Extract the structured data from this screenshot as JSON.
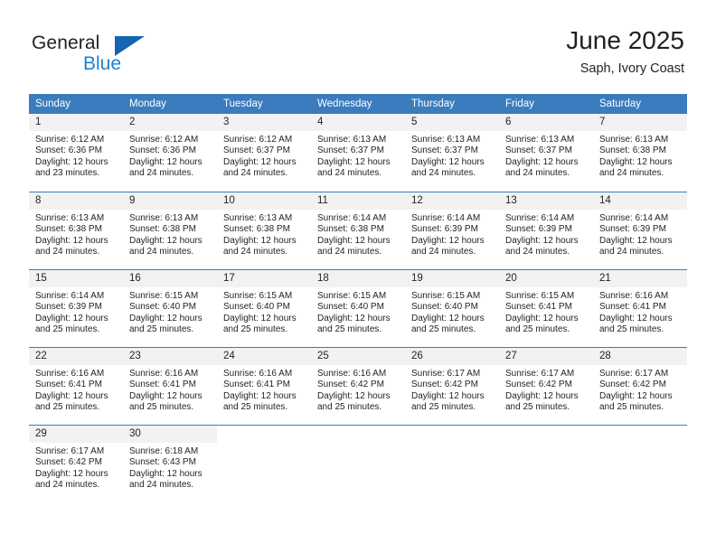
{
  "logo": {
    "word_top": "General",
    "word_bottom": "Blue",
    "triangle_color": "#1565b0",
    "blue_color": "#1f7fd1"
  },
  "header": {
    "title": "June 2025",
    "subtitle": "Saph, Ivory Coast"
  },
  "theme": {
    "header_blue": "#3a7cbe",
    "daynum_gray": "#f2f2f2",
    "text": "#231f20"
  },
  "weekday_headers": [
    "Sunday",
    "Monday",
    "Tuesday",
    "Wednesday",
    "Thursday",
    "Friday",
    "Saturday"
  ],
  "weeks": [
    [
      {
        "day": "1",
        "sunrise": "Sunrise: 6:12 AM",
        "sunset": "Sunset: 6:36 PM",
        "daylight_1": "Daylight: 12 hours",
        "daylight_2": "and 23 minutes."
      },
      {
        "day": "2",
        "sunrise": "Sunrise: 6:12 AM",
        "sunset": "Sunset: 6:36 PM",
        "daylight_1": "Daylight: 12 hours",
        "daylight_2": "and 24 minutes."
      },
      {
        "day": "3",
        "sunrise": "Sunrise: 6:12 AM",
        "sunset": "Sunset: 6:37 PM",
        "daylight_1": "Daylight: 12 hours",
        "daylight_2": "and 24 minutes."
      },
      {
        "day": "4",
        "sunrise": "Sunrise: 6:13 AM",
        "sunset": "Sunset: 6:37 PM",
        "daylight_1": "Daylight: 12 hours",
        "daylight_2": "and 24 minutes."
      },
      {
        "day": "5",
        "sunrise": "Sunrise: 6:13 AM",
        "sunset": "Sunset: 6:37 PM",
        "daylight_1": "Daylight: 12 hours",
        "daylight_2": "and 24 minutes."
      },
      {
        "day": "6",
        "sunrise": "Sunrise: 6:13 AM",
        "sunset": "Sunset: 6:37 PM",
        "daylight_1": "Daylight: 12 hours",
        "daylight_2": "and 24 minutes."
      },
      {
        "day": "7",
        "sunrise": "Sunrise: 6:13 AM",
        "sunset": "Sunset: 6:38 PM",
        "daylight_1": "Daylight: 12 hours",
        "daylight_2": "and 24 minutes."
      }
    ],
    [
      {
        "day": "8",
        "sunrise": "Sunrise: 6:13 AM",
        "sunset": "Sunset: 6:38 PM",
        "daylight_1": "Daylight: 12 hours",
        "daylight_2": "and 24 minutes."
      },
      {
        "day": "9",
        "sunrise": "Sunrise: 6:13 AM",
        "sunset": "Sunset: 6:38 PM",
        "daylight_1": "Daylight: 12 hours",
        "daylight_2": "and 24 minutes."
      },
      {
        "day": "10",
        "sunrise": "Sunrise: 6:13 AM",
        "sunset": "Sunset: 6:38 PM",
        "daylight_1": "Daylight: 12 hours",
        "daylight_2": "and 24 minutes."
      },
      {
        "day": "11",
        "sunrise": "Sunrise: 6:14 AM",
        "sunset": "Sunset: 6:38 PM",
        "daylight_1": "Daylight: 12 hours",
        "daylight_2": "and 24 minutes."
      },
      {
        "day": "12",
        "sunrise": "Sunrise: 6:14 AM",
        "sunset": "Sunset: 6:39 PM",
        "daylight_1": "Daylight: 12 hours",
        "daylight_2": "and 24 minutes."
      },
      {
        "day": "13",
        "sunrise": "Sunrise: 6:14 AM",
        "sunset": "Sunset: 6:39 PM",
        "daylight_1": "Daylight: 12 hours",
        "daylight_2": "and 24 minutes."
      },
      {
        "day": "14",
        "sunrise": "Sunrise: 6:14 AM",
        "sunset": "Sunset: 6:39 PM",
        "daylight_1": "Daylight: 12 hours",
        "daylight_2": "and 24 minutes."
      }
    ],
    [
      {
        "day": "15",
        "sunrise": "Sunrise: 6:14 AM",
        "sunset": "Sunset: 6:39 PM",
        "daylight_1": "Daylight: 12 hours",
        "daylight_2": "and 25 minutes."
      },
      {
        "day": "16",
        "sunrise": "Sunrise: 6:15 AM",
        "sunset": "Sunset: 6:40 PM",
        "daylight_1": "Daylight: 12 hours",
        "daylight_2": "and 25 minutes."
      },
      {
        "day": "17",
        "sunrise": "Sunrise: 6:15 AM",
        "sunset": "Sunset: 6:40 PM",
        "daylight_1": "Daylight: 12 hours",
        "daylight_2": "and 25 minutes."
      },
      {
        "day": "18",
        "sunrise": "Sunrise: 6:15 AM",
        "sunset": "Sunset: 6:40 PM",
        "daylight_1": "Daylight: 12 hours",
        "daylight_2": "and 25 minutes."
      },
      {
        "day": "19",
        "sunrise": "Sunrise: 6:15 AM",
        "sunset": "Sunset: 6:40 PM",
        "daylight_1": "Daylight: 12 hours",
        "daylight_2": "and 25 minutes."
      },
      {
        "day": "20",
        "sunrise": "Sunrise: 6:15 AM",
        "sunset": "Sunset: 6:41 PM",
        "daylight_1": "Daylight: 12 hours",
        "daylight_2": "and 25 minutes."
      },
      {
        "day": "21",
        "sunrise": "Sunrise: 6:16 AM",
        "sunset": "Sunset: 6:41 PM",
        "daylight_1": "Daylight: 12 hours",
        "daylight_2": "and 25 minutes."
      }
    ],
    [
      {
        "day": "22",
        "sunrise": "Sunrise: 6:16 AM",
        "sunset": "Sunset: 6:41 PM",
        "daylight_1": "Daylight: 12 hours",
        "daylight_2": "and 25 minutes."
      },
      {
        "day": "23",
        "sunrise": "Sunrise: 6:16 AM",
        "sunset": "Sunset: 6:41 PM",
        "daylight_1": "Daylight: 12 hours",
        "daylight_2": "and 25 minutes."
      },
      {
        "day": "24",
        "sunrise": "Sunrise: 6:16 AM",
        "sunset": "Sunset: 6:41 PM",
        "daylight_1": "Daylight: 12 hours",
        "daylight_2": "and 25 minutes."
      },
      {
        "day": "25",
        "sunrise": "Sunrise: 6:16 AM",
        "sunset": "Sunset: 6:42 PM",
        "daylight_1": "Daylight: 12 hours",
        "daylight_2": "and 25 minutes."
      },
      {
        "day": "26",
        "sunrise": "Sunrise: 6:17 AM",
        "sunset": "Sunset: 6:42 PM",
        "daylight_1": "Daylight: 12 hours",
        "daylight_2": "and 25 minutes."
      },
      {
        "day": "27",
        "sunrise": "Sunrise: 6:17 AM",
        "sunset": "Sunset: 6:42 PM",
        "daylight_1": "Daylight: 12 hours",
        "daylight_2": "and 25 minutes."
      },
      {
        "day": "28",
        "sunrise": "Sunrise: 6:17 AM",
        "sunset": "Sunset: 6:42 PM",
        "daylight_1": "Daylight: 12 hours",
        "daylight_2": "and 25 minutes."
      }
    ],
    [
      {
        "day": "29",
        "sunrise": "Sunrise: 6:17 AM",
        "sunset": "Sunset: 6:42 PM",
        "daylight_1": "Daylight: 12 hours",
        "daylight_2": "and 24 minutes."
      },
      {
        "day": "30",
        "sunrise": "Sunrise: 6:18 AM",
        "sunset": "Sunset: 6:43 PM",
        "daylight_1": "Daylight: 12 hours",
        "daylight_2": "and 24 minutes."
      },
      {
        "day": "",
        "sunrise": "",
        "sunset": "",
        "daylight_1": "",
        "daylight_2": ""
      },
      {
        "day": "",
        "sunrise": "",
        "sunset": "",
        "daylight_1": "",
        "daylight_2": ""
      },
      {
        "day": "",
        "sunrise": "",
        "sunset": "",
        "daylight_1": "",
        "daylight_2": ""
      },
      {
        "day": "",
        "sunrise": "",
        "sunset": "",
        "daylight_1": "",
        "daylight_2": ""
      },
      {
        "day": "",
        "sunrise": "",
        "sunset": "",
        "daylight_1": "",
        "daylight_2": ""
      }
    ]
  ]
}
